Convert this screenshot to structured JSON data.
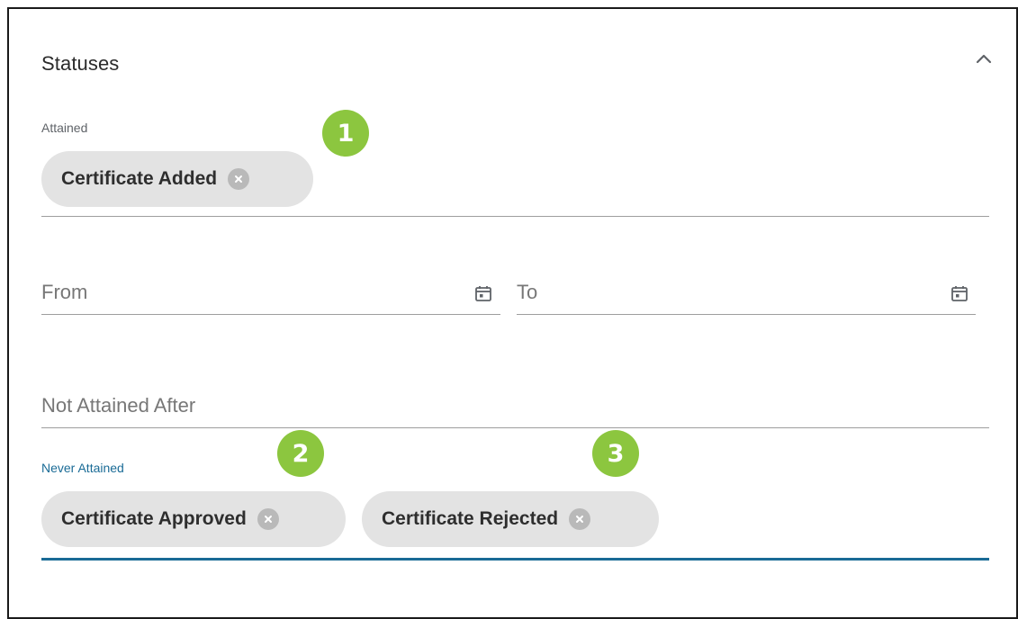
{
  "panel": {
    "title": "Statuses",
    "collapse_icon": "chevron-up-icon"
  },
  "attained": {
    "label": "Attained",
    "chips": [
      {
        "label": "Certificate Added",
        "remove_icon": "close-circle-icon"
      }
    ]
  },
  "date_range": {
    "from_placeholder": "From",
    "to_placeholder": "To",
    "calendar_icon": "calendar-icon"
  },
  "not_attained_after": {
    "placeholder": "Not Attained After"
  },
  "never_attained": {
    "label": "Never Attained",
    "chips": [
      {
        "label": "Certificate Approved",
        "remove_icon": "close-circle-icon"
      },
      {
        "label": "Certificate Rejected",
        "remove_icon": "close-circle-icon"
      }
    ]
  },
  "markers": [
    "1",
    "2",
    "3"
  ],
  "colors": {
    "marker": "#8cc63f",
    "chip_bg": "#e3e3e3",
    "focus_accent": "#1a6b96",
    "border": "#1a1a1a"
  }
}
